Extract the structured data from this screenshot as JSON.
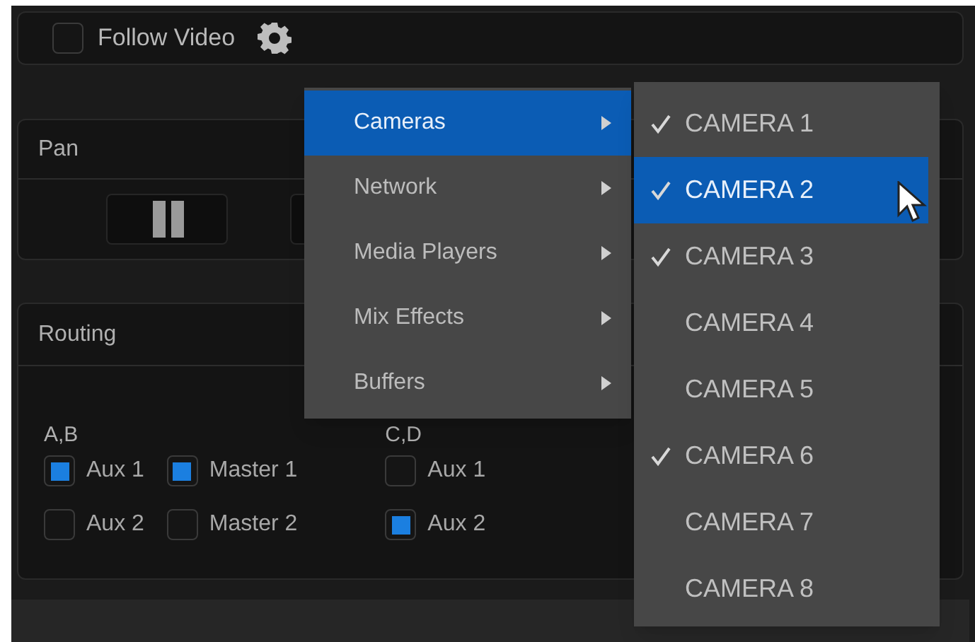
{
  "follow_video": {
    "label": "Follow Video",
    "checked": false
  },
  "pan": {
    "title": "Pan"
  },
  "routing": {
    "title": "Routing",
    "groups": [
      {
        "label": "A,B",
        "columns": [
          [
            {
              "label": "Aux 1",
              "checked": true
            },
            {
              "label": "Aux 2",
              "checked": false
            }
          ],
          [
            {
              "label": "Master 1",
              "checked": true
            },
            {
              "label": "Master 2",
              "checked": false
            }
          ]
        ]
      },
      {
        "label": "C,D",
        "columns": [
          [
            {
              "label": "Aux 1",
              "checked": false
            },
            {
              "label": "Aux 2",
              "checked": true
            }
          ]
        ]
      }
    ]
  },
  "menu": {
    "items": [
      {
        "label": "Cameras",
        "selected": true,
        "submenu": true
      },
      {
        "label": "Network",
        "selected": false,
        "submenu": true
      },
      {
        "label": "Media Players",
        "selected": false,
        "submenu": true
      },
      {
        "label": "Mix Effects",
        "selected": false,
        "submenu": true
      },
      {
        "label": "Buffers",
        "selected": false,
        "submenu": true
      }
    ]
  },
  "submenu": {
    "items": [
      {
        "label": "CAMERA 1",
        "checked": true,
        "selected": false
      },
      {
        "label": "CAMERA 2",
        "checked": true,
        "selected": true
      },
      {
        "label": "CAMERA 3",
        "checked": true,
        "selected": false
      },
      {
        "label": "CAMERA 4",
        "checked": false,
        "selected": false
      },
      {
        "label": "CAMERA 5",
        "checked": false,
        "selected": false
      },
      {
        "label": "CAMERA 6",
        "checked": true,
        "selected": false
      },
      {
        "label": "CAMERA 7",
        "checked": false,
        "selected": false
      },
      {
        "label": "CAMERA 8",
        "checked": false,
        "selected": false
      }
    ]
  }
}
